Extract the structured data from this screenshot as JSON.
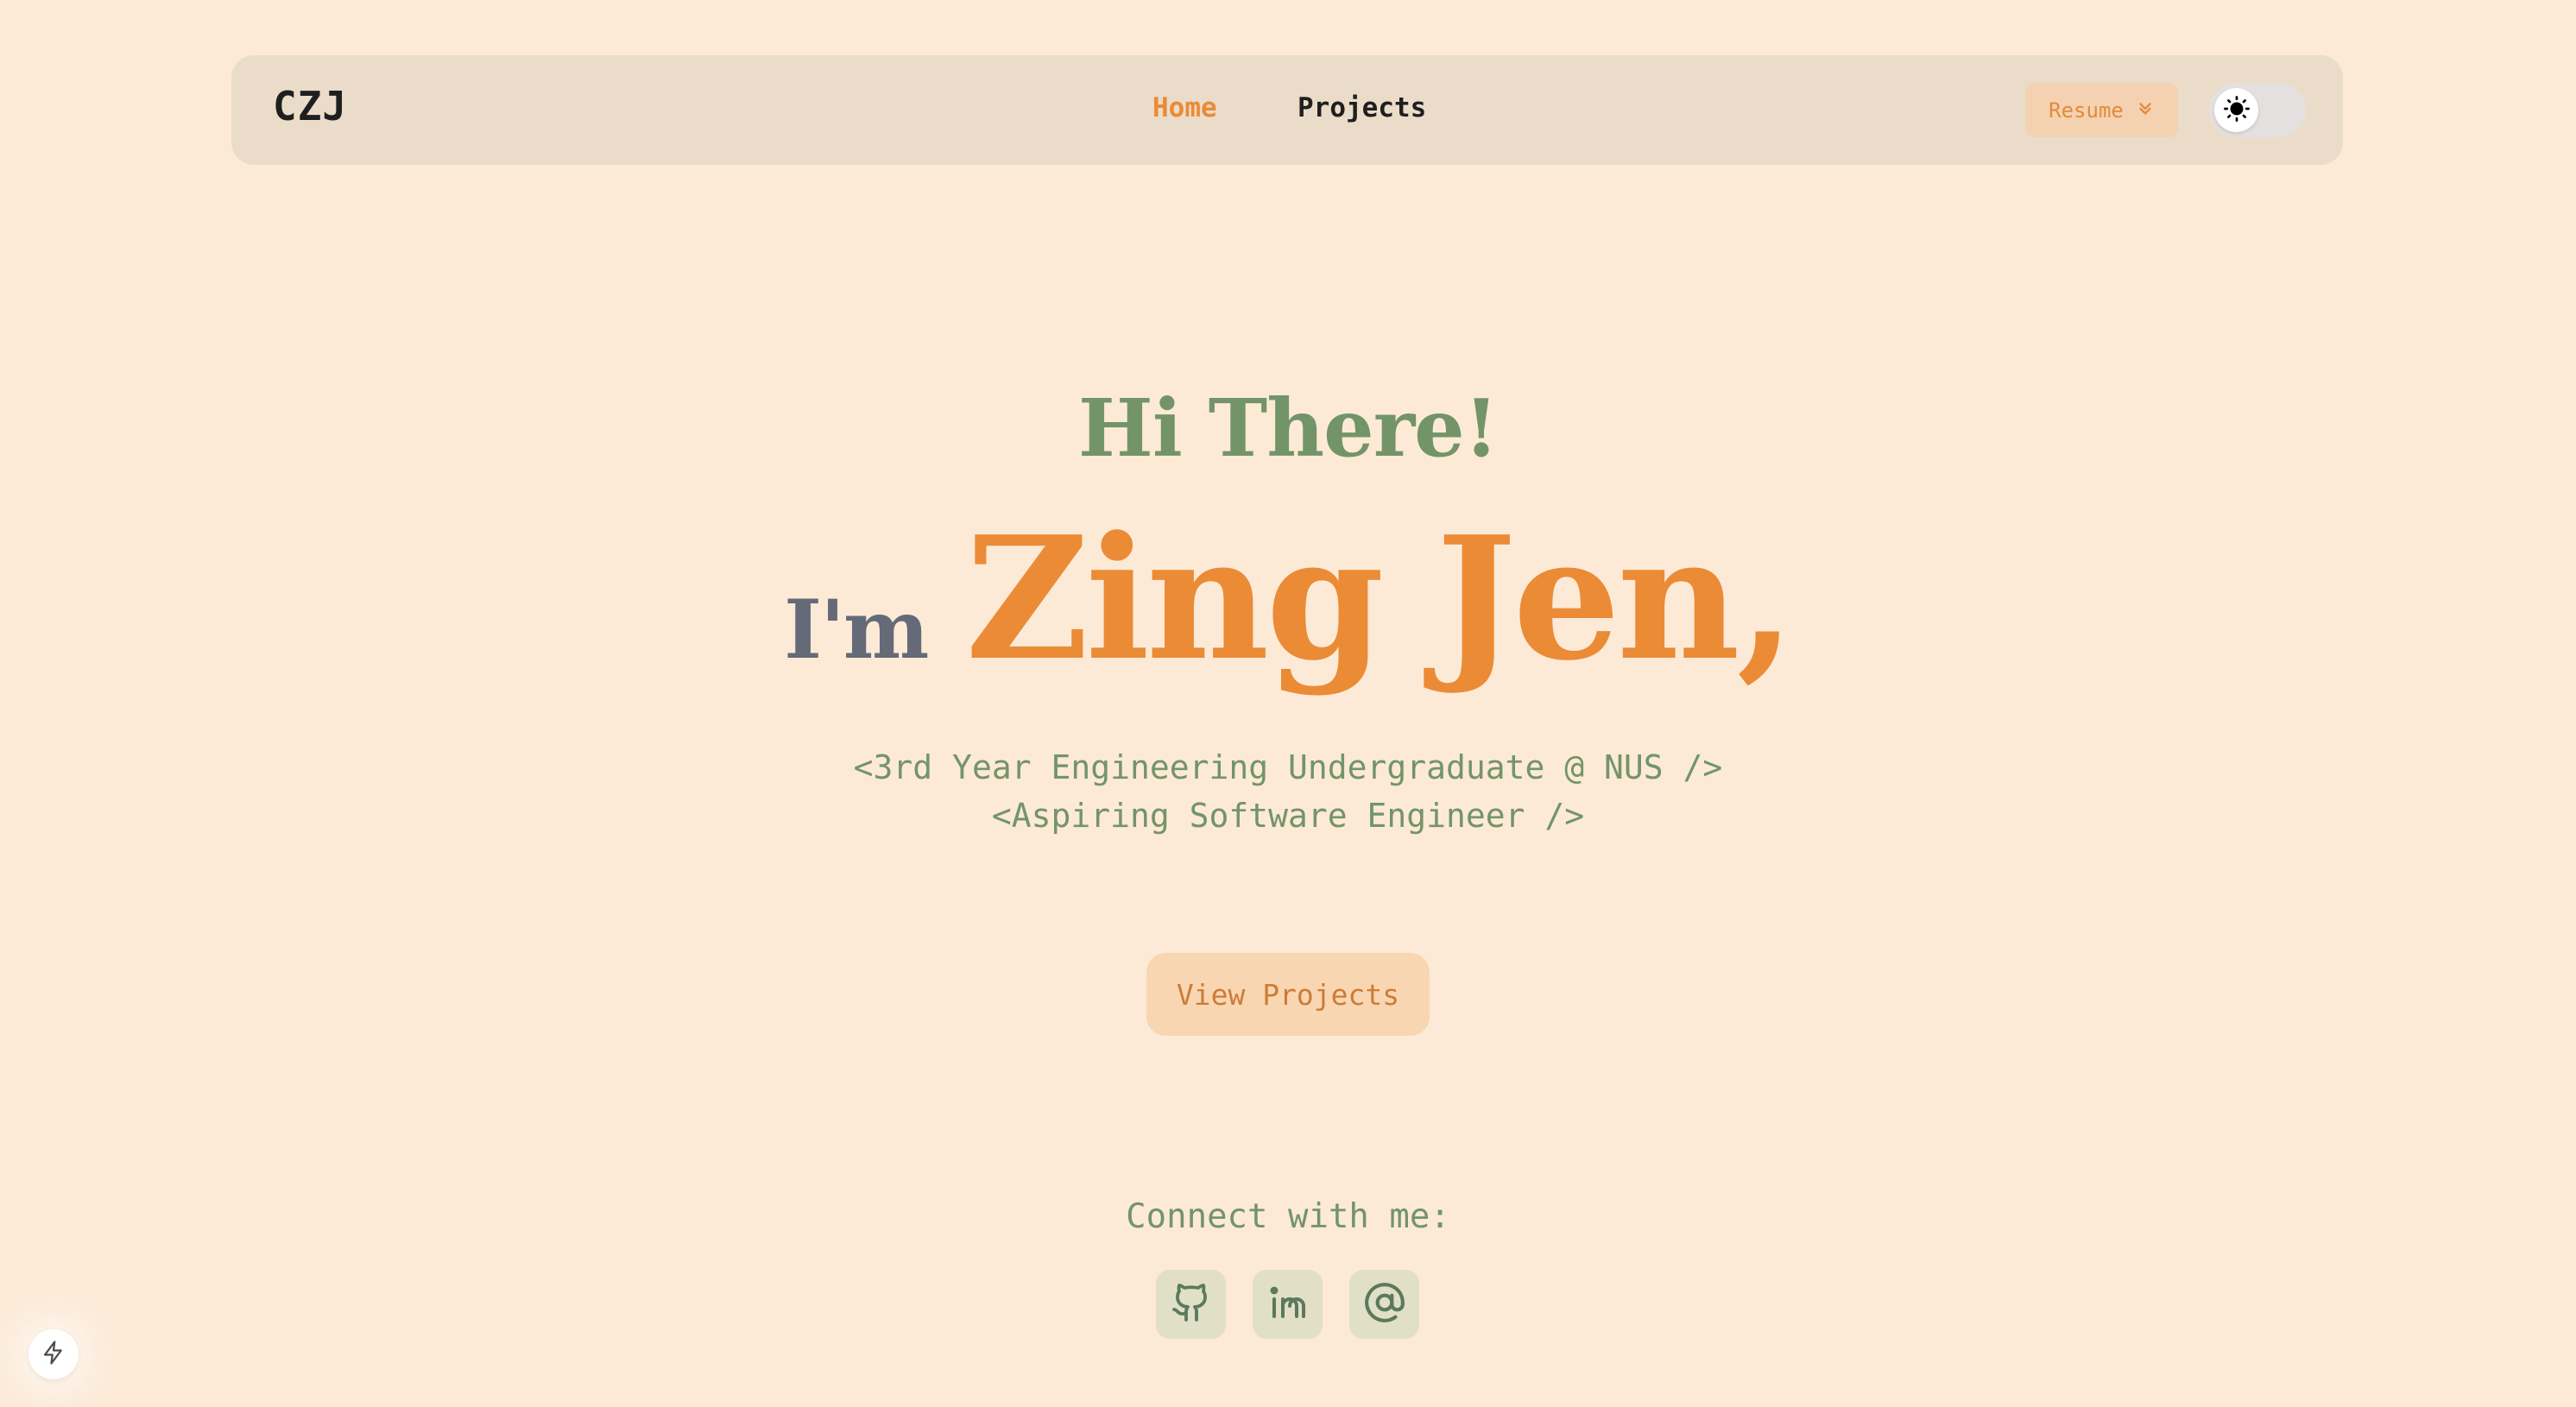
{
  "nav": {
    "logo": "CZJ",
    "links": [
      {
        "label": "Home",
        "active": true
      },
      {
        "label": "Projects",
        "active": false
      }
    ],
    "resume_label": "Resume",
    "resume_icon": "chevrons-down-icon",
    "theme_toggle_icon": "sun-icon"
  },
  "hero": {
    "greeting": "Hi There!",
    "im_label": "I'm",
    "name": "Zing Jen,",
    "subtitle_lines": [
      "<3rd Year Engineering Undergraduate @ NUS />",
      "<Aspiring Software Engineer />"
    ],
    "cta_label": "View Projects"
  },
  "connect": {
    "label": "Connect with me:",
    "icons": [
      "github-icon",
      "linkedin-icon",
      "email-at-icon"
    ]
  },
  "corner_badge_icon": "lightning-bolt-icon",
  "colors": {
    "background": "#fcead7",
    "navbar": "#ebdcca",
    "accent_orange": "#eb8b36",
    "accent_green": "#739469",
    "slate": "#646a78"
  }
}
